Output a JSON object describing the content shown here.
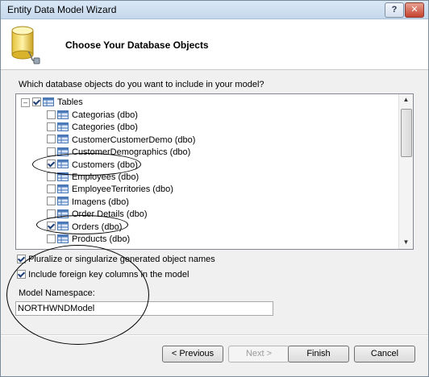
{
  "window": {
    "title": "Entity Data Model Wizard",
    "help_glyph": "?",
    "close_glyph": "✕"
  },
  "header": {
    "title": "Choose Your Database Objects"
  },
  "objects": {
    "prompt": "Which database objects do you want to include in your model?",
    "root": {
      "label": "Tables",
      "checked": true,
      "expander": "–"
    },
    "items": [
      {
        "label": "Categorias (dbo)",
        "checked": false
      },
      {
        "label": "Categories (dbo)",
        "checked": false
      },
      {
        "label": "CustomerCustomerDemo (dbo)",
        "checked": false
      },
      {
        "label": "CustomerDemographics (dbo)",
        "checked": false
      },
      {
        "label": "Customers (dbo)",
        "checked": true
      },
      {
        "label": "Employees (dbo)",
        "checked": false
      },
      {
        "label": "EmployeeTerritories (dbo)",
        "checked": false
      },
      {
        "label": "Imagens (dbo)",
        "checked": false
      },
      {
        "label": "Order Details (dbo)",
        "checked": false
      },
      {
        "label": "Orders (dbo)",
        "checked": true
      },
      {
        "label": "Products (dbo)",
        "checked": false
      }
    ],
    "scroll_up": "▲",
    "scroll_down": "▼"
  },
  "options": {
    "pluralize": {
      "label": "Pluralize or singularize generated object names",
      "checked": true
    },
    "foreign_keys": {
      "label": "Include foreign key columns in the model",
      "checked": true
    }
  },
  "namespace": {
    "label": "Model Namespace:",
    "value": "NORTHWNDModel"
  },
  "buttons": {
    "previous": "< Previous",
    "next": "Next >",
    "finish": "Finish",
    "cancel": "Cancel"
  },
  "colors": {
    "check": "#1e3f78",
    "table_icon_border": "#4c79b8",
    "table_icon_fill": "#dbe7f7"
  }
}
